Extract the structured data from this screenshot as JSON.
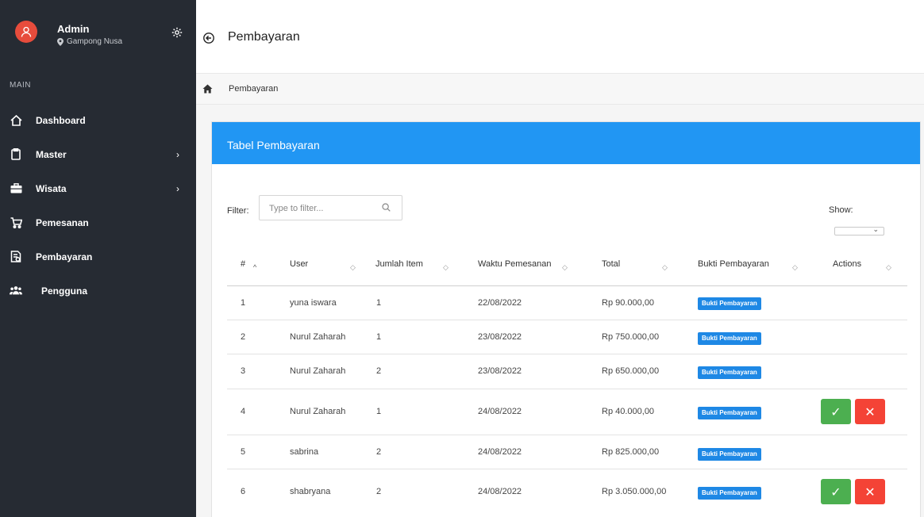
{
  "profile": {
    "name": "Admin",
    "location": "Gampong Nusa"
  },
  "sidebar": {
    "section": "MAIN",
    "items": [
      {
        "label": "Dashboard",
        "icon": "home-icon",
        "has_submenu": false
      },
      {
        "label": "Master",
        "icon": "clipboard-icon",
        "has_submenu": true
      },
      {
        "label": "Wisata",
        "icon": "briefcase-icon",
        "has_submenu": true
      },
      {
        "label": "Pemesanan",
        "icon": "cart-icon",
        "has_submenu": false
      },
      {
        "label": "Pembayaran",
        "icon": "payment-icon",
        "has_submenu": false
      },
      {
        "label": "Pengguna",
        "icon": "users-icon",
        "has_submenu": false
      }
    ]
  },
  "header": {
    "title": "Pembayaran"
  },
  "breadcrumb": {
    "current": "Pembayaran"
  },
  "card": {
    "title": "Tabel Pembayaran"
  },
  "filter": {
    "label": "Filter:",
    "placeholder": "Type to filter..."
  },
  "show": {
    "label": "Show:"
  },
  "table": {
    "columns": [
      "#",
      "User",
      "Jumlah Item",
      "Waktu Pemesanan",
      "Total",
      "Bukti Pembayaran",
      "Actions"
    ],
    "rows": [
      {
        "no": "1",
        "user": "yuna iswara",
        "jumlah": "1",
        "waktu": "22/08/2022",
        "total": "Rp 90.000,00",
        "bukti": "Bukti Pembayaran",
        "actions": false
      },
      {
        "no": "2",
        "user": "Nurul Zaharah",
        "jumlah": "1",
        "waktu": "23/08/2022",
        "total": "Rp 750.000,00",
        "bukti": "Bukti Pembayaran",
        "actions": false
      },
      {
        "no": "3",
        "user": "Nurul Zaharah",
        "jumlah": "2",
        "waktu": "23/08/2022",
        "total": "Rp 650.000,00",
        "bukti": "Bukti Pembayaran",
        "actions": false
      },
      {
        "no": "4",
        "user": "Nurul Zaharah",
        "jumlah": "1",
        "waktu": "24/08/2022",
        "total": "Rp 40.000,00",
        "bukti": "Bukti Pembayaran",
        "actions": true
      },
      {
        "no": "5",
        "user": "sabrina",
        "jumlah": "2",
        "waktu": "24/08/2022",
        "total": "Rp 825.000,00",
        "bukti": "Bukti Pembayaran",
        "actions": false
      },
      {
        "no": "6",
        "user": "shabryana",
        "jumlah": "2",
        "waktu": "24/08/2022",
        "total": "Rp 3.050.000,00",
        "bukti": "Bukti Pembayaran",
        "actions": true
      }
    ]
  },
  "actions": {
    "approve": "✓",
    "reject": "✕"
  },
  "colors": {
    "sidebar_bg": "#262b33",
    "accent": "#2196f3",
    "approve": "#4caf50",
    "reject": "#f44336",
    "badge": "#1e88e5",
    "avatar": "#e74c3c"
  }
}
